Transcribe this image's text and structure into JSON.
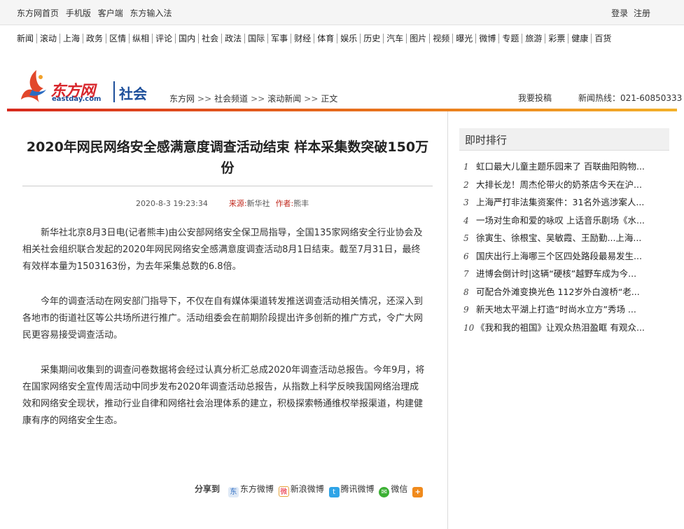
{
  "topbar": {
    "links": [
      "东方网首页",
      "手机版",
      "客户端",
      "东方输入法"
    ],
    "login": "登录",
    "register": "注册"
  },
  "nav": [
    "新闻",
    "滚动",
    "上海",
    "政务",
    "区情",
    "纵相",
    "评论",
    "国内",
    "社会",
    "政法",
    "国际",
    "军事",
    "财经",
    "体育",
    "娱乐",
    "历史",
    "汽车",
    "图片",
    "视频",
    "曝光",
    "微博",
    "专题",
    "旅游",
    "彩票",
    "健康",
    "百货"
  ],
  "header": {
    "logo_name": "东方网",
    "logo_domain": "eastday.com",
    "channel": "社会",
    "breadcrumb": [
      "东方网",
      "社会频道",
      "滚动新闻",
      "正文"
    ],
    "breadcrumb_sep": ">>",
    "submit": "我要投稿",
    "hotline": "新闻热线：021-60850333"
  },
  "article": {
    "title": "2020年网民网络安全感满意度调查活动结束 样本采集数突破150万份",
    "datetime": "2020-8-3 19:23:34",
    "source_label": "来源:",
    "source": "新华社",
    "author_label": "作者:",
    "author": "熊丰",
    "paragraphs": [
      "新华社北京8月3日电(记者熊丰)由公安部网络安全保卫局指导，全国135家网络安全行业协会及相关社会组织联合发起的2020年网民网络安全感满意度调查活动8月1日结束。截至7月31日，最终有效样本量为1503163份，为去年采集总数的6.8倍。",
      "今年的调查活动在网安部门指导下，不仅在自有媒体渠道转发推送调查活动相关情况，还深入到各地市的街道社区等公共场所进行推广。活动组委会在前期阶段提出许多创新的推广方式，令广大网民更容易接受调查活动。",
      "采集期间收集到的调查问卷数据将会经过认真分析汇总成2020年调查活动总报告。今年9月，将在国家网络安全宣传周活动中同步发布2020年调查活动总报告，从指数上科学反映我国网络治理成效和网络安全现状，推动行业自律和网络社会治理体系的建立，积极探索畅通维权举报渠道，构建健康有序的网络安全生态。"
    ],
    "share_label": "分享到",
    "share": [
      "东方微博",
      "新浪微博",
      "腾讯微博",
      "微信"
    ]
  },
  "sidebar": {
    "title": "即时排行",
    "items": [
      {
        "n": "1",
        "t": "虹口最大儿童主题乐园来了 百联曲阳购物..."
      },
      {
        "n": "2",
        "t": "大排长龙！周杰伦带火的奶茶店今天在沪..."
      },
      {
        "n": "3",
        "t": "上海严打非法集资案件：31名外逃涉案人..."
      },
      {
        "n": "4",
        "t": "一场对生命和爱的咏叹 上话音乐剧场《水..."
      },
      {
        "n": "5",
        "t": "徐寅生、徐根宝、吴敏霞、王励勤...上海..."
      },
      {
        "n": "6",
        "t": "国庆出行上海哪三个区四处路段最易发生..."
      },
      {
        "n": "7",
        "t": "进博会倒计时|这辆“硬核”越野车成为今..."
      },
      {
        "n": "8",
        "t": "可配合外滩变换光色 112岁外白渡桥“老..."
      },
      {
        "n": "9",
        "t": "新天地太平湖上打造“时尚水立方”秀场 ..."
      },
      {
        "n": "10",
        "t": "《我和我的祖国》让观众热泪盈眶 有观众..."
      }
    ]
  }
}
